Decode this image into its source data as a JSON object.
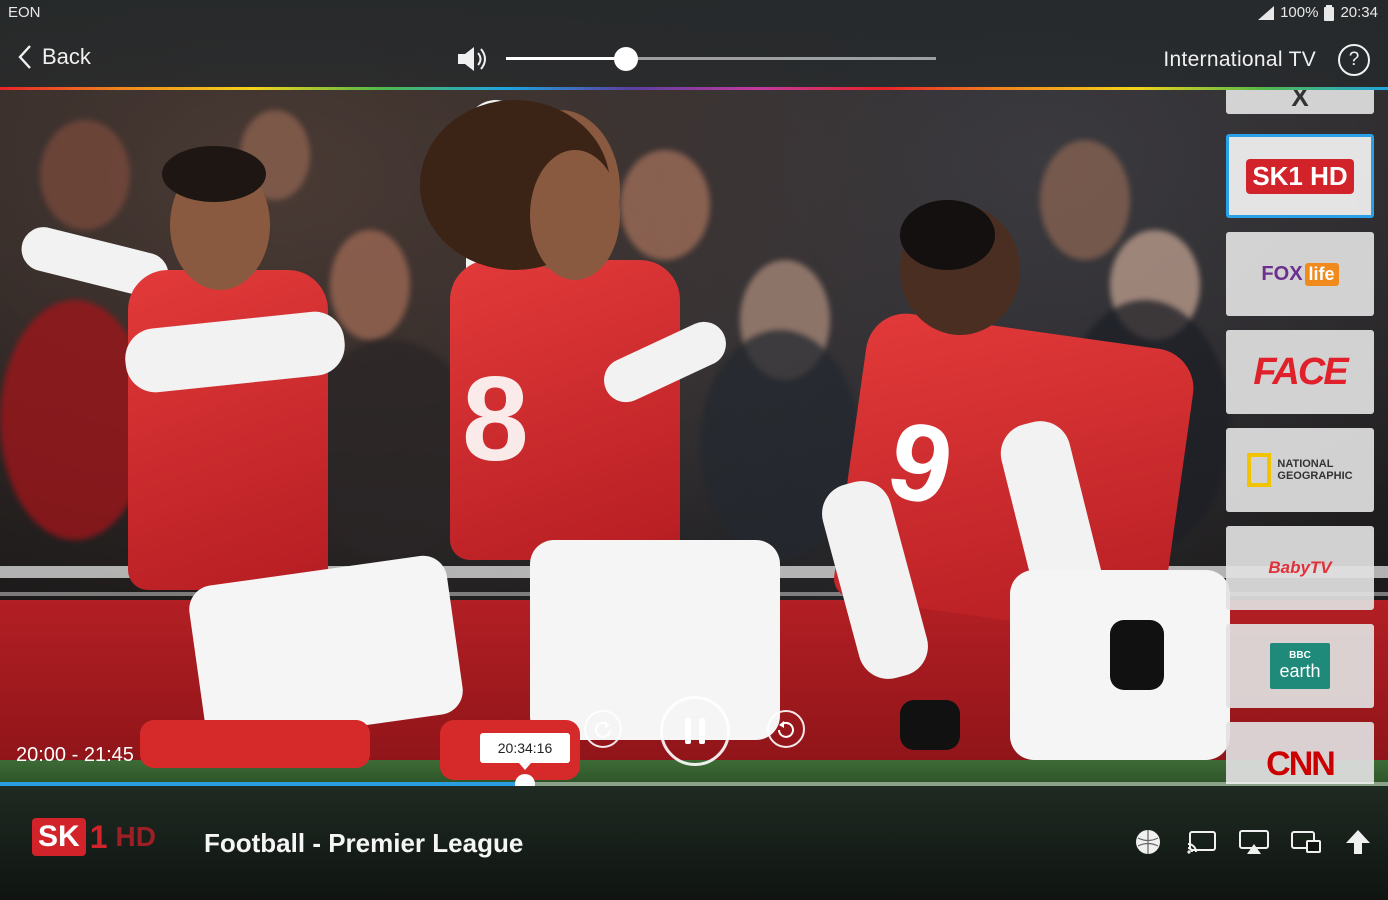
{
  "status_bar": {
    "carrier": "EON",
    "battery": "100%",
    "time": "20:34"
  },
  "header": {
    "back_label": "Back",
    "section_title": "International TV",
    "help_label": "?",
    "volume_level": 0.28
  },
  "channels": [
    {
      "name": "X",
      "logo_text": "X"
    },
    {
      "name": "SK1 HD",
      "logo_text": "SK1 HD",
      "selected": true
    },
    {
      "name": "FOX life",
      "logo_text_1": "FOX",
      "logo_text_2": "life"
    },
    {
      "name": "FACE",
      "logo_text": "FACE"
    },
    {
      "name": "NATIONAL GEOGRAPHIC",
      "logo_text_1": "NATIONAL",
      "logo_text_2": "GEOGRAPHIC"
    },
    {
      "name": "Baby TV",
      "logo_text": "BabyTV"
    },
    {
      "name": "BBC earth",
      "logo_text_1": "BBC",
      "logo_text_2": "earth"
    },
    {
      "name": "CNN",
      "logo_text": "CNN"
    }
  ],
  "player": {
    "time_range": "20:00 - 21:45",
    "current_time": "20:34:16",
    "progress": 0.378
  },
  "now_playing": {
    "channel_logo_1": "SK",
    "channel_logo_2": "1",
    "channel_logo_3": "HD",
    "program_title": "Football - Premier League"
  },
  "colors": {
    "accent": "#2a9ee0",
    "brand_red": "#e8232a"
  },
  "icons": {
    "back": "chevron-left-icon",
    "volume": "speaker-icon",
    "help": "question-circle-icon",
    "rewind": "replay-icon",
    "pause": "pause-icon",
    "restart": "restart-icon",
    "sports": "ball-icon",
    "cast": "cast-icon",
    "airplay": "airplay-icon",
    "pip": "picture-in-picture-icon",
    "up": "arrow-up-icon"
  }
}
